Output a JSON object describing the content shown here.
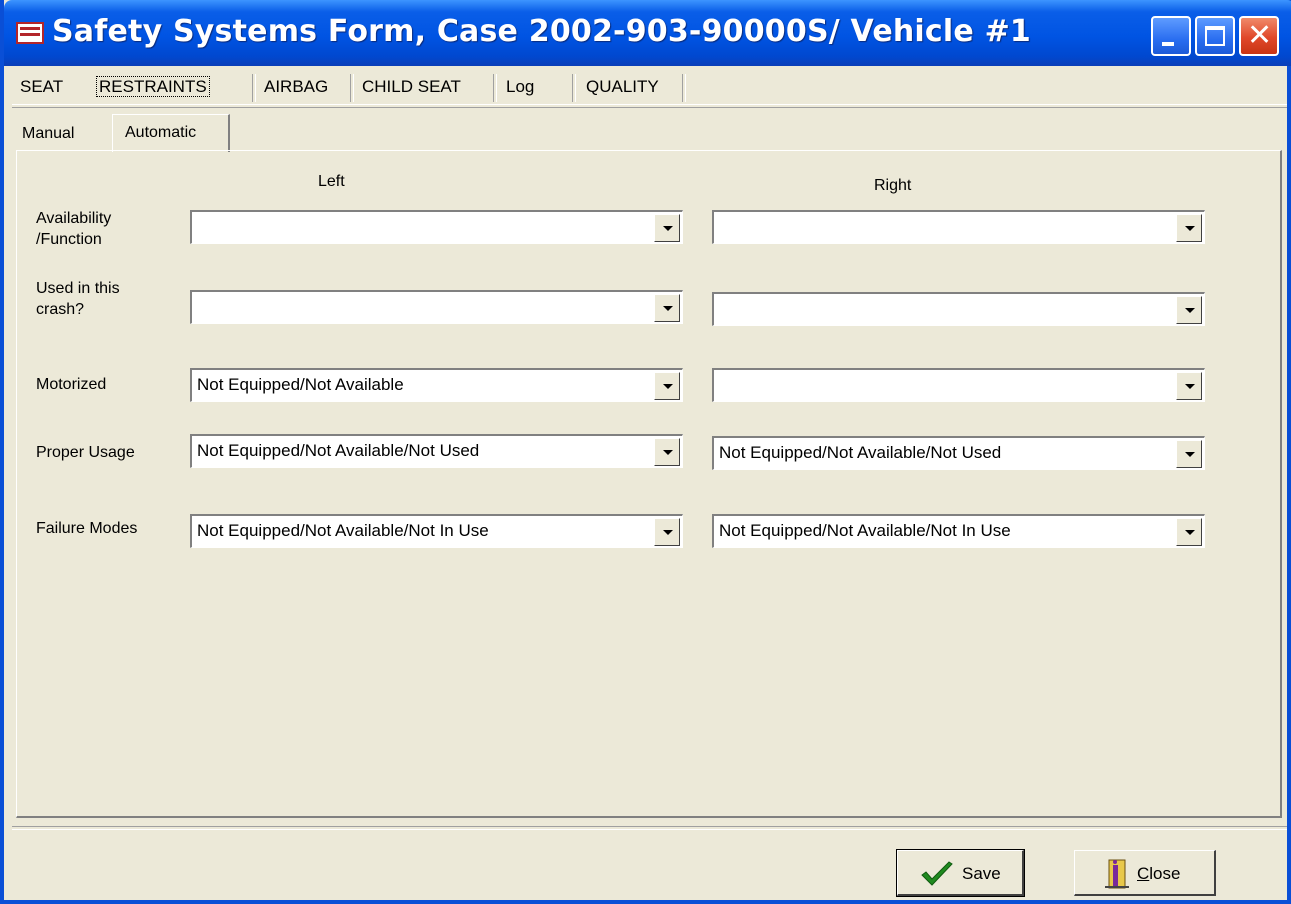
{
  "window": {
    "title": "Safety Systems Form, Case 2002-903-90000S/ Vehicle #1",
    "controls": {
      "minimize": "minimize",
      "maximize": "maximize",
      "close": "close"
    }
  },
  "outer_tabs": [
    {
      "label": "SEAT"
    },
    {
      "label": "RESTRAINTS",
      "active": true
    },
    {
      "label": "AIRBAG"
    },
    {
      "label": "CHILD SEAT"
    },
    {
      "label": "Log"
    },
    {
      "label": "QUALITY"
    }
  ],
  "inner_tabs": [
    {
      "label": "Manual"
    },
    {
      "label": "Automatic",
      "active": true
    }
  ],
  "form": {
    "left_header": "Left",
    "right_header": "Right",
    "rows": [
      {
        "label_line1": "Availability",
        "label_line2": "/Function",
        "left": "",
        "right": ""
      },
      {
        "label_line1": "Used in this",
        "label_line2": "crash?",
        "left": "",
        "right": ""
      },
      {
        "label_line1": "Motorized",
        "label_line2": "",
        "left": "Not Equipped/Not Available",
        "right": ""
      },
      {
        "label_line1": "Proper Usage",
        "label_line2": "",
        "left": "Not Equipped/Not Available/Not Used",
        "right": "Not Equipped/Not Available/Not Used"
      },
      {
        "label_line1": "Failure Modes",
        "label_line2": "",
        "left": "Not Equipped/Not Available/Not In Use",
        "right": "Not Equipped/Not Available/Not In Use"
      }
    ]
  },
  "buttons": {
    "save_label": "Save",
    "save_icon": "checkmark-icon",
    "close_label": "Close",
    "close_icon": "door-exit-icon"
  },
  "colors": {
    "titlebar": "#0054e3",
    "window_bg": "#ece9d8",
    "close_button": "#e0482a"
  }
}
